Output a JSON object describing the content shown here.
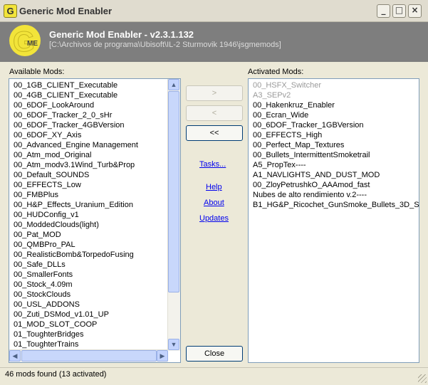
{
  "window": {
    "title": "Generic Mod Enabler",
    "controls": {
      "minimize": "_",
      "maximize": "□",
      "close": "×"
    }
  },
  "header": {
    "app_title": "Generic Mod Enabler - v2.3.1.132",
    "path": "[C:\\Archivos de programa\\Ubisoft\\IL-2 Sturmovik 1946\\jsgmemods]",
    "logo_letter": "G",
    "logo_sub": "ME"
  },
  "available": {
    "label": "Available Mods:",
    "items": [
      "00_1GB_CLIENT_Executable",
      "00_4GB_CLIENT_Executable",
      "00_6DOF_LookAround",
      "00_6DOF_Tracker_2_0_sHr",
      "00_6DOF_Tracker_4GBVersion",
      "00_6DOF_XY_Axis",
      "00_Advanced_Engine Management",
      "00_Atm_mod_Original",
      "00_Atm_modv3.1Wind_Turb&Prop",
      "00_Default_SOUNDS",
      "00_EFFECTS_Low",
      "00_FMBPlus",
      "00_H&P_Effects_Uranium_Edition",
      "00_HUDConfig_v1",
      "00_ModdedClouds(light)",
      "00_Pat_MOD",
      "00_QMBPro_PAL",
      "00_RealisticBomb&TorpedoFusing",
      "00_Safe_DLLs",
      "00_SmallerFonts",
      "00_Stock_4.09m",
      "00_StockClouds",
      "00_USL_ADDONS",
      "00_Zuti_DSMod_v1.01_UP",
      "01_MOD_SLOT_COOP",
      "01_ToughterBridges",
      "01_ToughterTrains"
    ]
  },
  "activated": {
    "label": "Activated Mods:",
    "items": [
      {
        "text": "00_HSFX_Switcher",
        "dim": true
      },
      {
        "text": "A3_SEPv2",
        "dim": true
      },
      {
        "text": "00_Hakenkruz_Enabler",
        "dim": false
      },
      {
        "text": "00_Ecran_Wide",
        "dim": false
      },
      {
        "text": "00_6DOF_Tracker_1GBVersion",
        "dim": false
      },
      {
        "text": "00_EFFECTS_High",
        "dim": false
      },
      {
        "text": "00_Perfect_Map_Textures",
        "dim": false
      },
      {
        "text": "00_Bullets_IntermittentSmoketrail",
        "dim": false
      },
      {
        "text": "A5_PropTex----",
        "dim": false
      },
      {
        "text": "A1_NAVLIGHTS_AND_DUST_MOD",
        "dim": false
      },
      {
        "text": "00_ZloyPetrushkO_AAAmod_fast",
        "dim": false
      },
      {
        "text": "Nubes de alto rendimiento v.2----",
        "dim": false
      },
      {
        "text": "B1_HG&P_Ricochet_GunSmoke_Bullets_3D_S...",
        "dim": false
      }
    ]
  },
  "buttons": {
    "activate": ">",
    "deactivate": "<",
    "deactivate_all": "<<",
    "close": "Close"
  },
  "links": {
    "tasks": "Tasks...",
    "help": "Help",
    "about": "About",
    "updates": "Updates"
  },
  "status": {
    "text": "46 mods found (13 activated)"
  },
  "colors": {
    "header_bg": "#7e7e7e",
    "logo_yellow": "#f2e43a",
    "link": "#0000ee"
  }
}
